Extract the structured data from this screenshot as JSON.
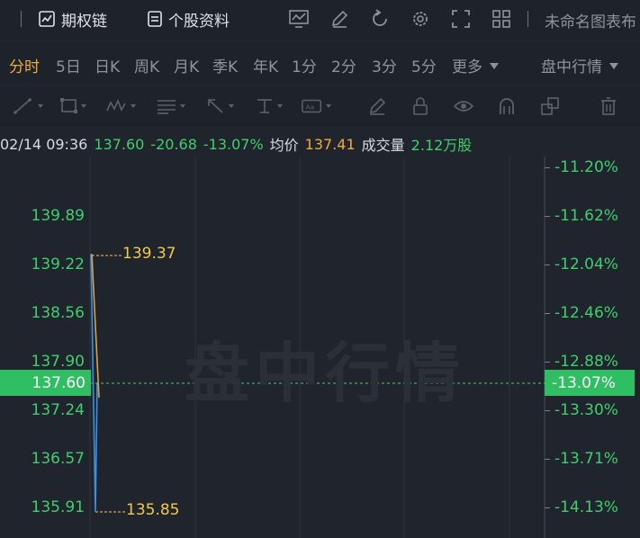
{
  "toolbar": {
    "options_chain_label": "期权链",
    "stock_profile_label": "个股资料",
    "layout_title": "未命名图表布"
  },
  "periods": [
    "分时",
    "5日",
    "日K",
    "周K",
    "月K",
    "季K",
    "年K",
    "1分",
    "2分",
    "3分",
    "5分",
    "更多"
  ],
  "active_period": "分时",
  "session_select": "盘中行情",
  "quote": {
    "datetime": "02/14 09:36",
    "price": "137.60",
    "change": "-20.68",
    "change_pct": "-13.07%",
    "avg_label": "均价",
    "avg_price": "137.41",
    "volume_label": "成交量",
    "volume": "2.12万股"
  },
  "axis": {
    "left_labels": [
      "139.89",
      "139.22",
      "138.56",
      "137.90",
      "137.24",
      "136.57",
      "135.91"
    ],
    "right_labels": [
      "-11.20%",
      "-11.62%",
      "-12.04%",
      "-12.46%",
      "-12.88%",
      "-13.30%",
      "-13.71%",
      "-14.13%"
    ],
    "current_price_tag": "137.60",
    "current_pct_tag": "-13.07%"
  },
  "watermark": "盘中行情",
  "chart_data": {
    "type": "line",
    "series": [
      {
        "name": "",
        "values": [
          139.37,
          135.85,
          137.6
        ]
      },
      {
        "name": "均价",
        "values": [
          139.37,
          137.41
        ]
      }
    ],
    "high_label": "139.37",
    "low_label": "135.85",
    "colors": {
      "price": "#3f8fe0",
      "avg": "#d8a24a",
      "up_down": "#3fcf6e",
      "annotation": "#f2c94c"
    }
  }
}
